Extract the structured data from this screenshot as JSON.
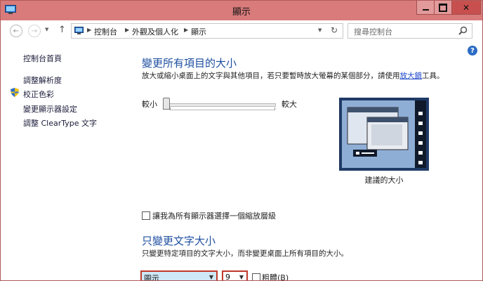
{
  "window": {
    "title": "顯示",
    "controls": {
      "minimize": "minimize",
      "maximize": "maximize",
      "close": "✕"
    }
  },
  "nav": {
    "breadcrumb": [
      "控制台",
      "外觀及個人化",
      "顯示"
    ],
    "search_placeholder": "搜尋控制台"
  },
  "sidebar": {
    "items": [
      {
        "label": "控制台首頁"
      },
      {
        "label": "調整解析度"
      },
      {
        "label": "校正色彩",
        "icon": "shield-icon"
      },
      {
        "label": "變更顯示器設定"
      },
      {
        "label": "調整 ClearType 文字"
      }
    ]
  },
  "main": {
    "section1": {
      "heading": "變更所有項目的大小",
      "desc_before": "放大或縮小桌面上的文字與其他項目，若只要暫時放大螢幕的某個部分，請使用",
      "desc_link": "放大鏡",
      "desc_after": "工具。",
      "slider": {
        "min_label": "較小",
        "max_label": "較大",
        "value": 0
      },
      "preview_caption": "建議的大小"
    },
    "per_monitor_checkbox": {
      "label": "讓我為所有顯示器選擇一個縮放層級",
      "checked": false
    },
    "section2": {
      "heading": "只變更文字大小",
      "desc": "只變更特定項目的文字大小，而非變更桌面上所有項目的大小。",
      "item_select": "圖示",
      "size_select": "9",
      "bold_label": "粗體(B)",
      "bold_checked": false
    }
  },
  "colors": {
    "titlebar": "#d97b7b",
    "heading": "#1e4fa0",
    "link": "#1b45c9",
    "select_highlight": "#c0392b"
  }
}
